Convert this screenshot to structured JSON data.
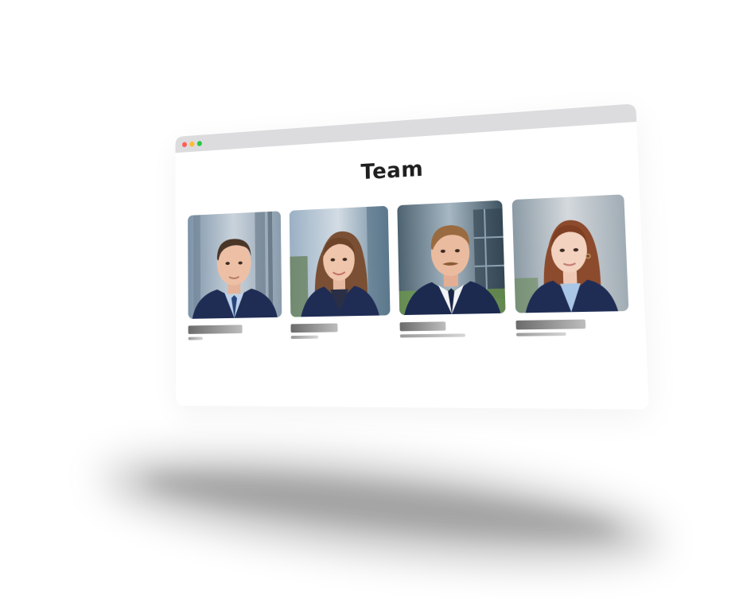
{
  "page": {
    "title": "Team"
  },
  "window_controls": {
    "close": "close-dot",
    "minimize": "minimize-dot",
    "maximize": "maximize-dot"
  },
  "team": [
    {
      "photo": "man-navy-suit-short-hair",
      "name_placeholder_fraction": 0.58,
      "role_placeholder_fraction": 0.16
    },
    {
      "photo": "woman-navy-blazer-long-hair",
      "name_placeholder_fraction": 0.48,
      "role_placeholder_fraction": 0.28
    },
    {
      "photo": "man-navy-suit-mustache",
      "name_placeholder_fraction": 0.44,
      "role_placeholder_fraction": 0.62
    },
    {
      "photo": "woman-navy-blazer-red-hair",
      "name_placeholder_fraction": 0.62,
      "role_placeholder_fraction": 0.45
    }
  ],
  "colors": {
    "titlebar": "#dcdcdf",
    "close": "#ff5f57",
    "minimize": "#febc2e",
    "maximize": "#28c840",
    "suit": "#1f2d55",
    "title_text": "#1f1f1f"
  }
}
